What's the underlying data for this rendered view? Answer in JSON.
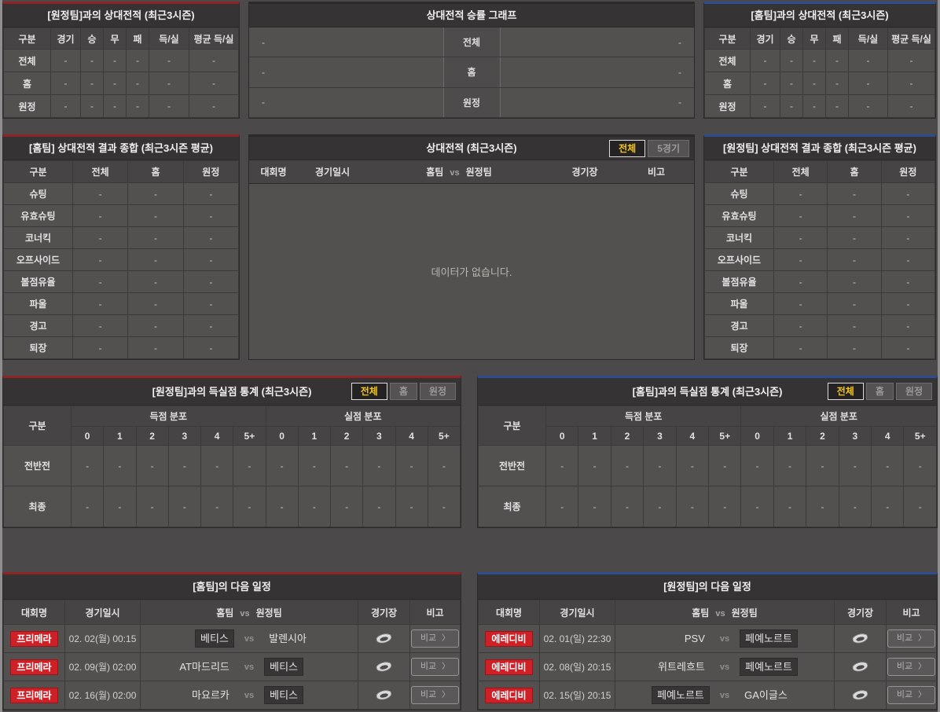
{
  "shared": {
    "vs": "vs",
    "compare_label": "비교",
    "chevron_icon": "〉",
    "empty_text": "데이터가 없습니다.",
    "tabs": {
      "all": "전체",
      "five": "5경기",
      "home": "홈",
      "away": "원정"
    },
    "list_columns": {
      "league": "대회명",
      "datetime": "경기일시",
      "home": "홈팀",
      "away": "원정팀",
      "stadium": "경기장",
      "note": "비고"
    },
    "goal_columns": {
      "group": "구분",
      "scored": "득점 분포",
      "conceded": "실점 분포",
      "ticks": [
        "0",
        "1",
        "2",
        "3",
        "4",
        "5+"
      ]
    }
  },
  "colors": {
    "accent_red": "#8e2424",
    "accent_blue": "#2d4d8f",
    "badge_red": "#ce2127",
    "tab_active_text": "#f3c51c"
  },
  "h2h_away": {
    "title": "[원정팀]과의 상대전적 (최근3시즌)",
    "columns": [
      "구분",
      "경기",
      "승",
      "무",
      "패",
      "득/실",
      "평균 득/실"
    ],
    "rows": [
      {
        "label": "전체",
        "values": [
          "-",
          "-",
          "-",
          "-",
          "-",
          "-"
        ]
      },
      {
        "label": "홈",
        "values": [
          "-",
          "-",
          "-",
          "-",
          "-",
          "-"
        ]
      },
      {
        "label": "원정",
        "values": [
          "-",
          "-",
          "-",
          "-",
          "-",
          "-"
        ]
      }
    ]
  },
  "winrate_graph": {
    "title": "상대전적 승률 그래프",
    "rows": [
      {
        "label": "전체",
        "left": "-",
        "right": "-"
      },
      {
        "label": "홈",
        "left": "-",
        "right": "-"
      },
      {
        "label": "원정",
        "left": "-",
        "right": "-"
      }
    ]
  },
  "h2h_home": {
    "title": "[홈팀]과의 상대전적 (최근3시즌)",
    "columns": [
      "구분",
      "경기",
      "승",
      "무",
      "패",
      "득/실",
      "평균 득/실"
    ],
    "rows": [
      {
        "label": "전체",
        "values": [
          "-",
          "-",
          "-",
          "-",
          "-",
          "-"
        ]
      },
      {
        "label": "홈",
        "values": [
          "-",
          "-",
          "-",
          "-",
          "-",
          "-"
        ]
      },
      {
        "label": "원정",
        "values": [
          "-",
          "-",
          "-",
          "-",
          "-",
          "-"
        ]
      }
    ]
  },
  "summary_home": {
    "title": "[홈팀] 상대전적 결과 종합 (최근3시즌 평균)",
    "columns": [
      "구분",
      "전체",
      "홈",
      "원정"
    ],
    "rows": [
      {
        "label": "슈팅",
        "values": [
          "-",
          "-",
          "-"
        ]
      },
      {
        "label": "유효슈팅",
        "values": [
          "-",
          "-",
          "-"
        ]
      },
      {
        "label": "코너킥",
        "values": [
          "-",
          "-",
          "-"
        ]
      },
      {
        "label": "오프사이드",
        "values": [
          "-",
          "-",
          "-"
        ]
      },
      {
        "label": "볼점유율",
        "values": [
          "-",
          "-",
          "-"
        ]
      },
      {
        "label": "파울",
        "values": [
          "-",
          "-",
          "-"
        ]
      },
      {
        "label": "경고",
        "values": [
          "-",
          "-",
          "-"
        ]
      },
      {
        "label": "퇴장",
        "values": [
          "-",
          "-",
          "-"
        ]
      }
    ]
  },
  "h2h_list": {
    "title": "상대전적 (최근3시즌)"
  },
  "summary_away": {
    "title": "[원정팀] 상대전적 결과 종합 (최근3시즌 평균)",
    "columns": [
      "구분",
      "전체",
      "홈",
      "원정"
    ],
    "rows": [
      {
        "label": "슈팅",
        "values": [
          "-",
          "-",
          "-"
        ]
      },
      {
        "label": "유효슈팅",
        "values": [
          "-",
          "-",
          "-"
        ]
      },
      {
        "label": "코너킥",
        "values": [
          "-",
          "-",
          "-"
        ]
      },
      {
        "label": "오프사이드",
        "values": [
          "-",
          "-",
          "-"
        ]
      },
      {
        "label": "볼점유율",
        "values": [
          "-",
          "-",
          "-"
        ]
      },
      {
        "label": "파울",
        "values": [
          "-",
          "-",
          "-"
        ]
      },
      {
        "label": "경고",
        "values": [
          "-",
          "-",
          "-"
        ]
      },
      {
        "label": "퇴장",
        "values": [
          "-",
          "-",
          "-"
        ]
      }
    ]
  },
  "goals_away": {
    "title": "[원정팀]과의 득실점 통계 (최근3시즌)",
    "rows": [
      {
        "label": "전반전",
        "scored": [
          "-",
          "-",
          "-",
          "-",
          "-",
          "-"
        ],
        "conceded": [
          "-",
          "-",
          "-",
          "-",
          "-",
          "-"
        ]
      },
      {
        "label": "최종",
        "scored": [
          "-",
          "-",
          "-",
          "-",
          "-",
          "-"
        ],
        "conceded": [
          "-",
          "-",
          "-",
          "-",
          "-",
          "-"
        ]
      }
    ]
  },
  "goals_home": {
    "title": "[홈팀]과의 득실점 통계 (최근3시즌)",
    "rows": [
      {
        "label": "전반전",
        "scored": [
          "-",
          "-",
          "-",
          "-",
          "-",
          "-"
        ],
        "conceded": [
          "-",
          "-",
          "-",
          "-",
          "-",
          "-"
        ]
      },
      {
        "label": "최종",
        "scored": [
          "-",
          "-",
          "-",
          "-",
          "-",
          "-"
        ],
        "conceded": [
          "-",
          "-",
          "-",
          "-",
          "-",
          "-"
        ]
      }
    ]
  },
  "schedule_home": {
    "title": "[홈팀]의 다음 일정",
    "rows": [
      {
        "league": "프리메라",
        "datetime": "02. 02(월) 00:15",
        "home": "베티스",
        "away": "발렌시아",
        "highlighted": "home"
      },
      {
        "league": "프리메라",
        "datetime": "02. 09(월) 02:00",
        "home": "AT마드리드",
        "away": "베티스",
        "highlighted": "away"
      },
      {
        "league": "프리메라",
        "datetime": "02. 16(월) 02:00",
        "home": "마요르카",
        "away": "베티스",
        "highlighted": "away"
      }
    ]
  },
  "schedule_away": {
    "title": "[원정팀]의 다음 일정",
    "rows": [
      {
        "league": "에레디비",
        "datetime": "02. 01(일) 22:30",
        "home": "PSV",
        "away": "페예노르트",
        "highlighted": "away"
      },
      {
        "league": "에레디비",
        "datetime": "02. 08(일) 20:15",
        "home": "위트레흐트",
        "away": "페예노르트",
        "highlighted": "away"
      },
      {
        "league": "에레디비",
        "datetime": "02. 15(일) 20:15",
        "home": "페예노르트",
        "away": "GA이글스",
        "highlighted": "home"
      }
    ]
  }
}
